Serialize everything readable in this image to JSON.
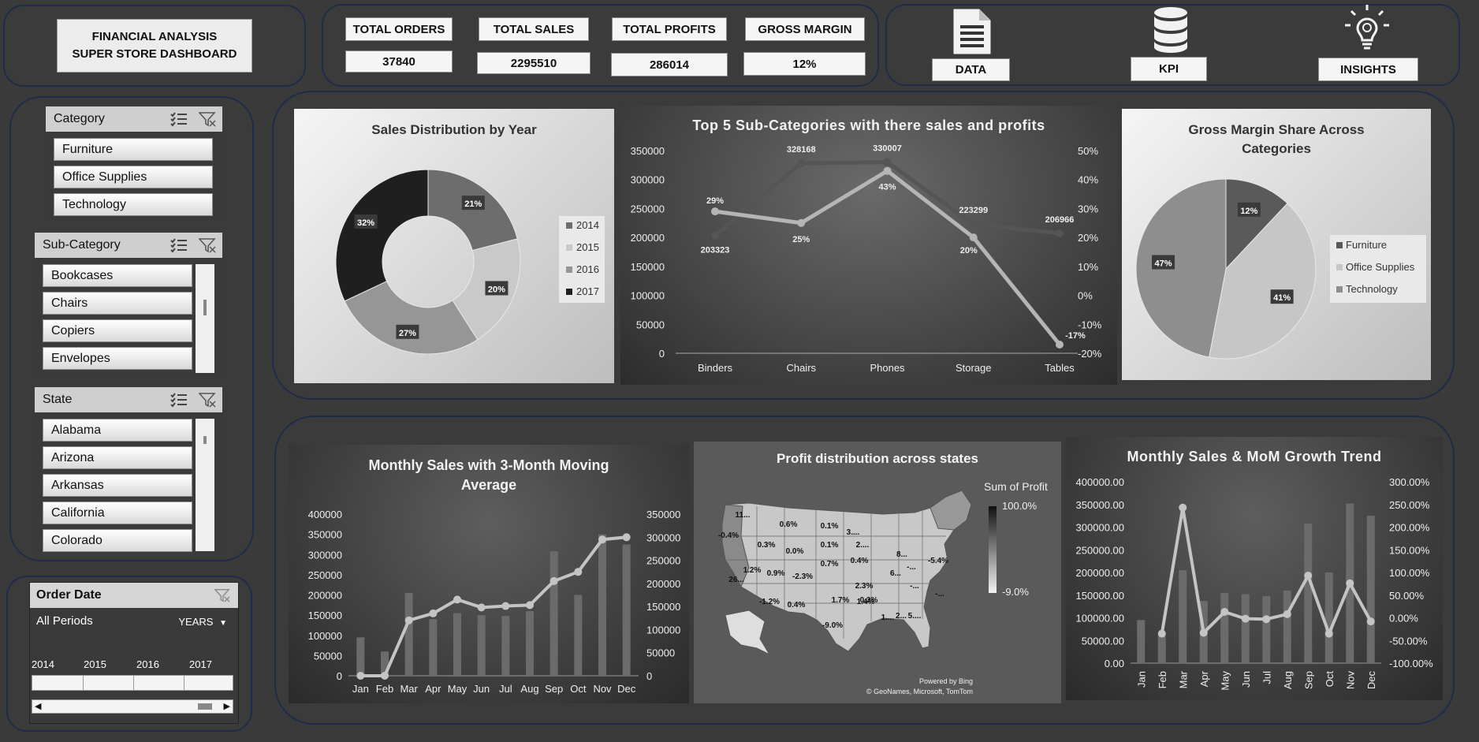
{
  "header": {
    "title_line1": "FINANCIAL ANALYSIS",
    "title_line2": "SUPER STORE DASHBOARD"
  },
  "kpis": [
    {
      "label": "TOTAL ORDERS",
      "value": "37840"
    },
    {
      "label": "TOTAL SALES",
      "value": "2295510"
    },
    {
      "label": "TOTAL PROFITS",
      "value": "286014"
    },
    {
      "label": "GROSS MARGIN",
      "value": "12%"
    }
  ],
  "nav": [
    {
      "label": "DATA",
      "icon": "document-icon"
    },
    {
      "label": "KPI",
      "icon": "database-icon"
    },
    {
      "label": "INSIGHTS",
      "icon": "lightbulb-icon"
    }
  ],
  "slicers": {
    "category": {
      "title": "Category",
      "items": [
        "Furniture",
        "Office Supplies",
        "Technology"
      ]
    },
    "subcategory": {
      "title": "Sub-Category",
      "items": [
        "Bookcases",
        "Chairs",
        "Copiers",
        "Envelopes"
      ]
    },
    "state": {
      "title": "State",
      "items": [
        "Alabama",
        "Arizona",
        "Arkansas",
        "California",
        "Colorado"
      ]
    }
  },
  "timeline": {
    "title": "Order Date",
    "period": "All Periods",
    "level": "YEARS",
    "years": [
      "2014",
      "2015",
      "2016",
      "2017"
    ]
  },
  "colors": {
    "background": "#3a3a3a",
    "panel_border": "#1f2b4a",
    "series_dark": "#1e1e1e",
    "series_mid": "#6f6f6f",
    "series_light": "#c9c9c9"
  },
  "chart_data": [
    {
      "type": "pie",
      "variant": "donut",
      "title": "Sales Distribution by Year",
      "categories": [
        "2014",
        "2015",
        "2016",
        "2017"
      ],
      "values": [
        21,
        20,
        27,
        32
      ],
      "labels": [
        "21%",
        "20%",
        "27%",
        "32%"
      ],
      "legend": "right"
    },
    {
      "type": "line",
      "title": "Top 5 Sub-Categories with there sales and profits",
      "categories": [
        "Binders",
        "Chairs",
        "Phones",
        "Storage",
        "Tables"
      ],
      "series": [
        {
          "axis": "left",
          "values": [
            203323,
            328168,
            330007,
            223299,
            206966
          ]
        },
        {
          "axis": "right",
          "values": [
            29,
            25,
            43,
            20,
            -17
          ],
          "labels": [
            "29%",
            "25%",
            "43%",
            "20%",
            "-17%"
          ]
        }
      ],
      "yticks_left": [
        "0",
        "50000",
        "100000",
        "150000",
        "200000",
        "250000",
        "300000",
        "350000"
      ],
      "yticks_right": [
        "-20%",
        "-10%",
        "0%",
        "10%",
        "20%",
        "30%",
        "40%",
        "50%"
      ],
      "ylim_left": [
        0,
        350000
      ],
      "ylim_right": [
        -20,
        50
      ]
    },
    {
      "type": "pie",
      "title": "Gross Margin Share Across Categories",
      "categories": [
        "Furniture",
        "Office Supplies",
        "Technology"
      ],
      "values": [
        12,
        41,
        47
      ],
      "labels": [
        "12%",
        "41%",
        "47%"
      ],
      "legend": "right"
    },
    {
      "type": "bar",
      "title": "Monthly Sales with 3-Month Moving Average",
      "categories": [
        "Jan",
        "Feb",
        "Mar",
        "Apr",
        "May",
        "Jun",
        "Jul",
        "Aug",
        "Sep",
        "Oct",
        "Nov",
        "Dec"
      ],
      "series": [
        {
          "kind": "bar",
          "axis": "left",
          "values": [
            95000,
            60000,
            205000,
            140000,
            155000,
            150000,
            148000,
            160000,
            308000,
            200000,
            350000,
            325000
          ]
        },
        {
          "kind": "line",
          "axis": "right",
          "values": [
            0,
            0,
            120000,
            135000,
            165000,
            148000,
            151000,
            153000,
            205000,
            225000,
            295000,
            300000
          ]
        }
      ],
      "yticks_left": [
        "0",
        "50000",
        "100000",
        "150000",
        "200000",
        "250000",
        "300000",
        "350000",
        "400000"
      ],
      "yticks_right": [
        "0",
        "50000",
        "100000",
        "150000",
        "200000",
        "250000",
        "300000",
        "350000"
      ],
      "ylim_left": [
        0,
        400000
      ],
      "ylim_right": [
        0,
        350000
      ]
    },
    {
      "type": "heatmap",
      "title": "Profit distribution across states",
      "legend_title": "Sum of Profit",
      "legend_max": "100.0%",
      "legend_min": "-9.0%",
      "labels": [
        "11...",
        "-0.4%",
        "0.6%",
        "0.1%",
        "3....",
        "0.3%",
        "0.0%",
        "0.1%",
        "2....",
        "1.2%",
        "0.9%",
        "-2.3%",
        "0.7%",
        "0.4%",
        "8...",
        "-5.4%",
        "-...",
        "6...",
        "-...",
        "26...",
        "0.3%",
        "2.3%",
        "-...",
        "-1.2%",
        "0.4%",
        "1.7%",
        "1.4%",
        "-9.0%",
        "1....",
        "2...",
        "5...."
      ],
      "credit1": "Powered by Bing",
      "credit2": "© GeoNames, Microsoft, TomTom"
    },
    {
      "type": "bar",
      "title": "Monthly Sales & MoM Growth Trend",
      "categories": [
        "Jan",
        "Feb",
        "Mar",
        "Apr",
        "May",
        "Jun",
        "Jul",
        "Aug",
        "Sep",
        "Oct",
        "Nov",
        "Dec"
      ],
      "series": [
        {
          "kind": "bar",
          "axis": "left",
          "values": [
            95000,
            60000,
            205000,
            137000,
            155000,
            152000,
            148000,
            160000,
            308000,
            200000,
            352000,
            325000
          ]
        },
        {
          "kind": "line",
          "axis": "right",
          "values": [
            null,
            -35,
            243,
            -33,
            13,
            -2,
            -3,
            8,
            93,
            -35,
            76,
            -8
          ]
        }
      ],
      "yticks_left": [
        "0.00",
        "50000.00",
        "100000.00",
        "150000.00",
        "200000.00",
        "250000.00",
        "300000.00",
        "350000.00",
        "400000.00"
      ],
      "yticks_right": [
        "-100.00%",
        "-50.00%",
        "0.00%",
        "50.00%",
        "100.00%",
        "150.00%",
        "200.00%",
        "250.00%",
        "300.00%"
      ],
      "ylim_left": [
        0,
        400000
      ],
      "ylim_right": [
        -100,
        300
      ]
    }
  ]
}
